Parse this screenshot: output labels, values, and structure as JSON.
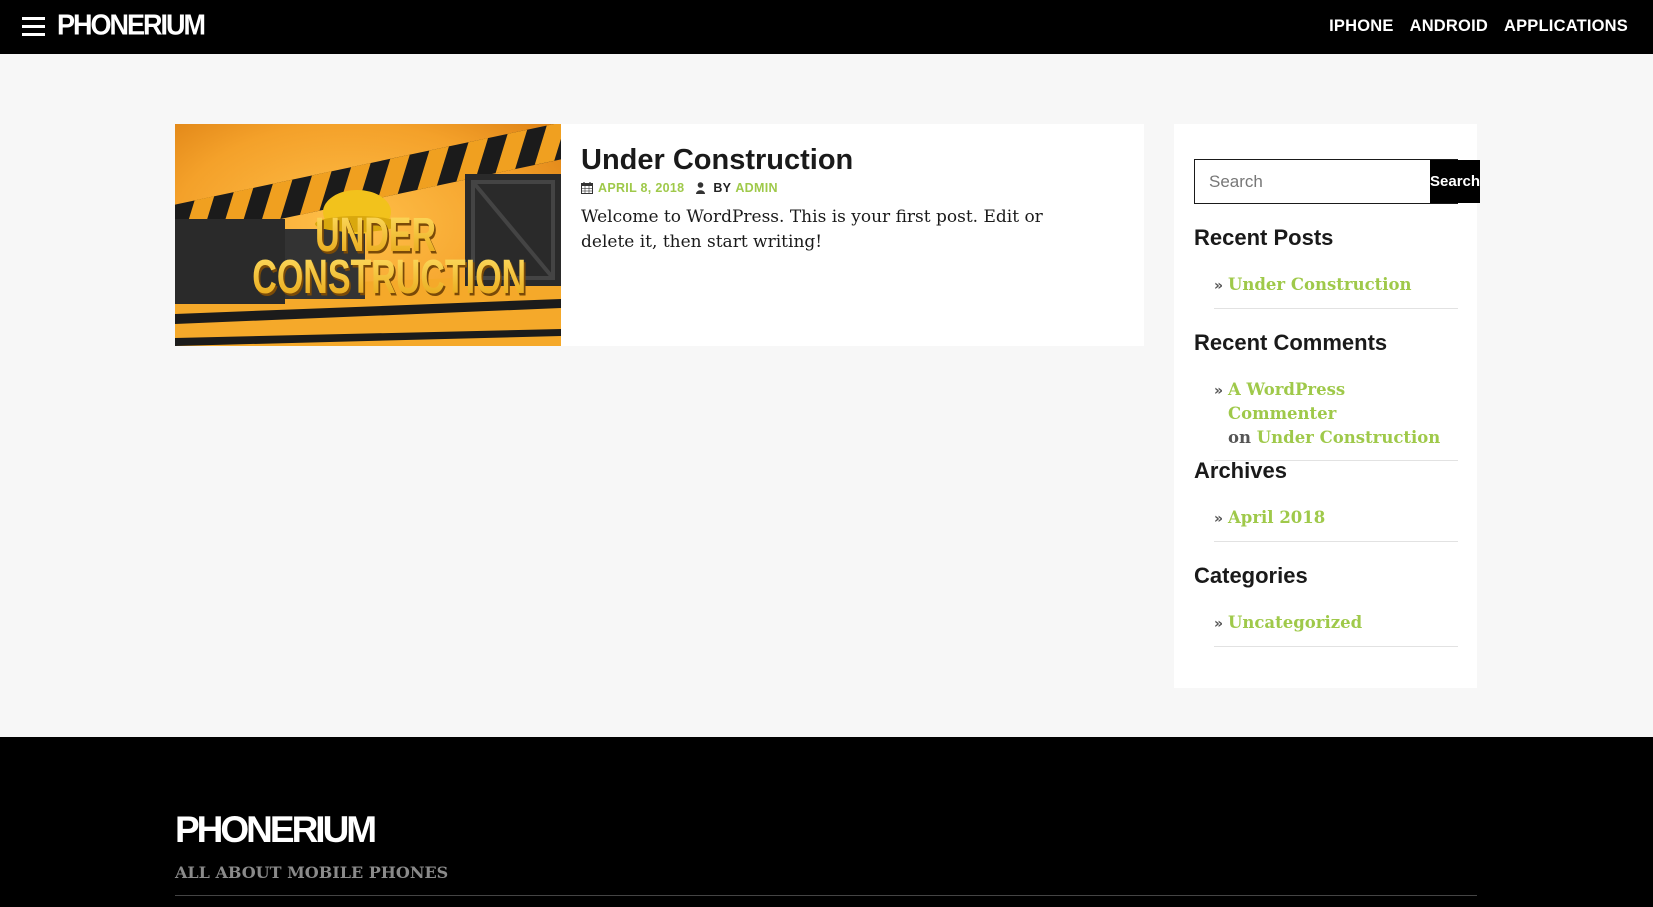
{
  "header": {
    "site_name": "PHONERIUM",
    "nav": [
      "IPHONE",
      "ANDROID",
      "APPLICATIONS"
    ]
  },
  "post": {
    "title": "Under Construction",
    "date": "APRIL 8, 2018",
    "by_label": "BY",
    "author": "ADMIN",
    "excerpt": "Welcome to WordPress. This is your first post. Edit or delete it, then start writing!",
    "image_text_1": "UNDER",
    "image_text_2": "CONSTRUCTION"
  },
  "sidebar": {
    "search": {
      "placeholder": "Search",
      "button_label": "Search"
    },
    "recent_posts": {
      "title": "Recent Posts",
      "items": [
        "Under Construction"
      ]
    },
    "recent_comments": {
      "title": "Recent Comments",
      "author": "A WordPress Commenter",
      "on_label": "on",
      "post": "Under Construction"
    },
    "archives": {
      "title": "Archives",
      "items": [
        "April 2018"
      ]
    },
    "categories": {
      "title": "Categories",
      "items": [
        "Uncategorized"
      ]
    }
  },
  "footer": {
    "site_name": "PHONERIUM",
    "tagline": "ALL ABOUT MOBILE PHONES"
  },
  "colors": {
    "accent": "#9fc94a",
    "header_bg": "#000000",
    "page_bg": "#f7f7f7"
  }
}
